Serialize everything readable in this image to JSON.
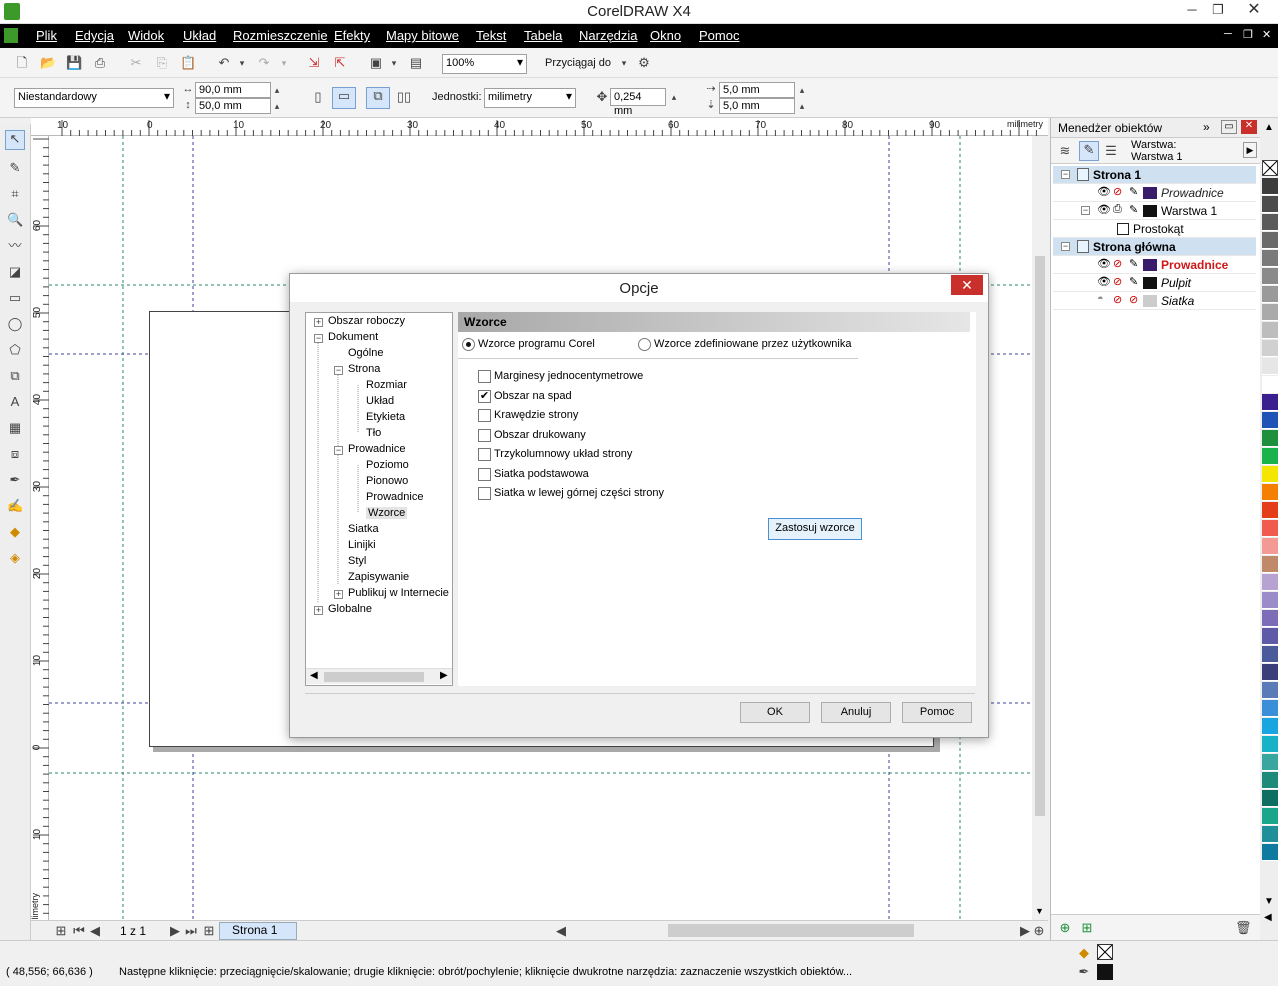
{
  "app": {
    "title": "CorelDRAW X4"
  },
  "menu": [
    "Plik",
    "Edycja",
    "Widok",
    "Układ",
    "Rozmieszczenie",
    "Efekty",
    "Mapy bitowe",
    "Tekst",
    "Tabela",
    "Narzędzia",
    "Okno",
    "Pomoc"
  ],
  "toolbar": {
    "zoom": "100%",
    "snap_label": "Przyciągaj do"
  },
  "property_bar": {
    "page_size": "Niestandardowy",
    "width": "90,0 mm",
    "height": "50,0 mm",
    "units_label": "Jednostki:",
    "units": "milimetry",
    "nudge": "0,254 mm",
    "dup_x": "5,0 mm",
    "dup_y": "5,0 mm"
  },
  "rulers": {
    "h": [
      "10",
      "0",
      "10",
      "20",
      "30",
      "40",
      "50",
      "60",
      "70",
      "80",
      "90"
    ],
    "h_unit": "milimetry",
    "v": [
      "60",
      "50",
      "40",
      "30",
      "20",
      "10",
      "0",
      "10"
    ],
    "v_unit": "milimetry"
  },
  "page_nav": {
    "count": "1 z 1",
    "tab": "Strona 1"
  },
  "status": {
    "coords": "( 48,556; 66,636 )",
    "message": "Następne kliknięcie: przeciągnięcie/skalowanie; drugie kliknięcie: obrót/pochylenie; kliknięcie dwukrotne narzędzia: zaznaczenie wszystkich obiektów..."
  },
  "docker": {
    "title": "Menedżer obiektów",
    "layer_label": "Warstwa:",
    "layer_value": "Warstwa 1",
    "rows": [
      {
        "label": "Strona 1",
        "kind": "page"
      },
      {
        "label": "Prowadnice",
        "kind": "layer",
        "style": "italic"
      },
      {
        "label": "Warstwa 1",
        "kind": "layer",
        "style": "normal"
      },
      {
        "label": "Prostokąt",
        "kind": "object"
      },
      {
        "label": "Strona główna",
        "kind": "page"
      },
      {
        "label": "Prowadnice",
        "kind": "layer",
        "style": "bold-red"
      },
      {
        "label": "Pulpit",
        "kind": "layer",
        "style": "italic"
      },
      {
        "label": "Siatka",
        "kind": "layer",
        "style": "italic"
      }
    ]
  },
  "dialog": {
    "title": "Opcje",
    "tree": [
      {
        "label": "Obszar roboczy",
        "lvl": 0,
        "exp": "+"
      },
      {
        "label": "Dokument",
        "lvl": 0,
        "exp": "−"
      },
      {
        "label": "Ogólne",
        "lvl": 1
      },
      {
        "label": "Strona",
        "lvl": 1,
        "exp": "−"
      },
      {
        "label": "Rozmiar",
        "lvl": 2
      },
      {
        "label": "Układ",
        "lvl": 2
      },
      {
        "label": "Etykieta",
        "lvl": 2
      },
      {
        "label": "Tło",
        "lvl": 2
      },
      {
        "label": "Prowadnice",
        "lvl": 1,
        "exp": "−"
      },
      {
        "label": "Poziomo",
        "lvl": 2
      },
      {
        "label": "Pionowo",
        "lvl": 2
      },
      {
        "label": "Prowadnice",
        "lvl": 2
      },
      {
        "label": "Wzorce",
        "lvl": 2,
        "selected": true
      },
      {
        "label": "Siatka",
        "lvl": 1
      },
      {
        "label": "Linijki",
        "lvl": 1
      },
      {
        "label": "Styl",
        "lvl": 1
      },
      {
        "label": "Zapisywanie",
        "lvl": 1
      },
      {
        "label": "Publikuj w Internecie",
        "lvl": 1,
        "exp": "+"
      },
      {
        "label": "Globalne",
        "lvl": 0,
        "exp": "+"
      }
    ],
    "section": "Wzorce",
    "radio": [
      {
        "label": "Wzorce programu Corel",
        "checked": true
      },
      {
        "label": "Wzorce zdefiniowane przez użytkownika",
        "checked": false
      }
    ],
    "checks": [
      {
        "label": "Marginesy jednocentymetrowe",
        "checked": false
      },
      {
        "label": "Obszar na spad",
        "checked": true
      },
      {
        "label": "Krawędzie strony",
        "checked": false
      },
      {
        "label": "Obszar drukowany",
        "checked": false
      },
      {
        "label": "Trzykolumnowy układ strony",
        "checked": false
      },
      {
        "label": "Siatka podstawowa",
        "checked": false
      },
      {
        "label": "Siatka w lewej górnej części strony",
        "checked": false
      }
    ],
    "apply": "Zastosuj wzorce",
    "ok": "OK",
    "cancel": "Anuluj",
    "help": "Pomoc"
  },
  "palette": [
    "#3c3c3c",
    "#4b4b4b",
    "#5a5a5a",
    "#6a6a6a",
    "#7a7a7a",
    "#8a8a8a",
    "#9a9a9a",
    "#aaaaaa",
    "#bdbdbd",
    "#d0d0d0",
    "#e6e6e6",
    "#ffffff",
    "#3b1f8f",
    "#1f53b5",
    "#1e8f3c",
    "#19b24b",
    "#f5e600",
    "#f57f00",
    "#e43d1a",
    "#f05a4f",
    "#f39a95",
    "#c08a6a",
    "#b6a3d1",
    "#9b8bc8",
    "#7d6db9",
    "#5e5aa8",
    "#4a5a9a",
    "#3a3f7a",
    "#5a7ab8",
    "#3a8fd8",
    "#19a6e0",
    "#17b2c8",
    "#3aa6a0",
    "#1e8a7a",
    "#0e6e62",
    "#1aa68a",
    "#1f8f9a",
    "#0e7aa0"
  ]
}
